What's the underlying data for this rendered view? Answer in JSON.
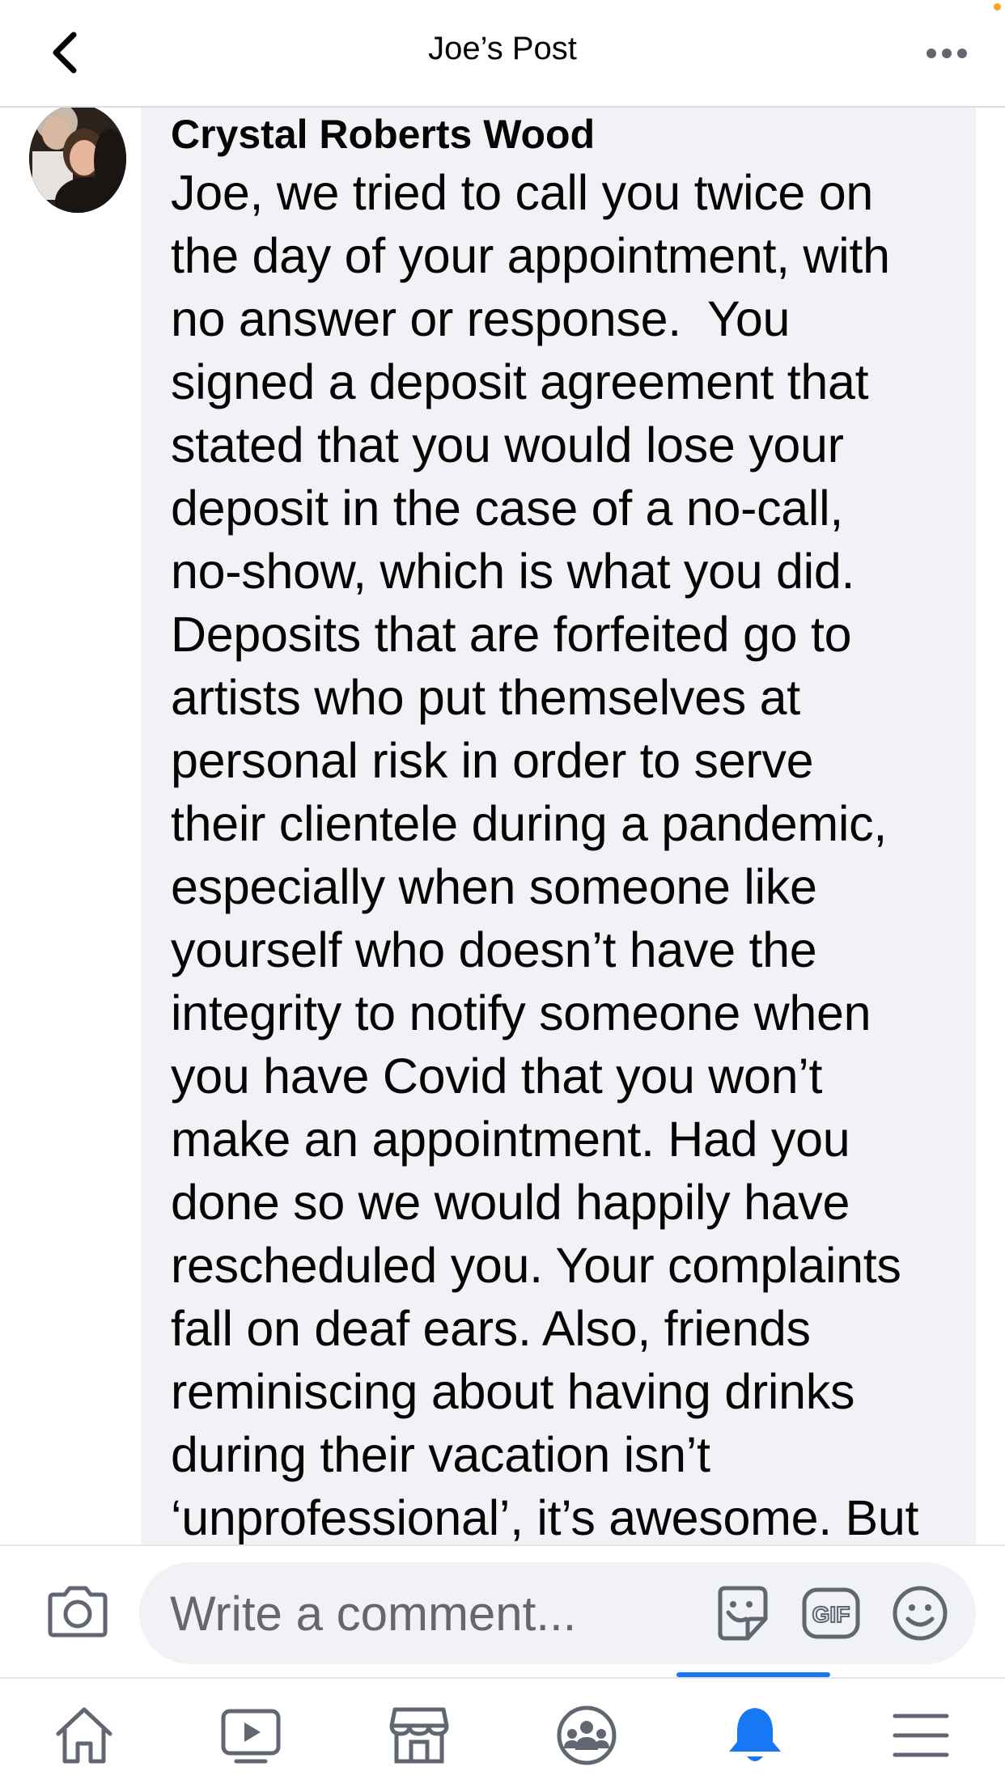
{
  "header": {
    "title": "Joe’s Post",
    "back_icon": "chevron-left-icon",
    "more_icon": "more-dots-icon"
  },
  "comment": {
    "author": "Crystal Roberts Wood",
    "lines": [
      "Joe, we tried to call you twice on",
      "the day of your appointment, with",
      "no answer or response.  You",
      "signed a deposit agreement that",
      "stated that you would lose your",
      "deposit in the case of a no-call,",
      "no-show, which is what you did.",
      "Deposits that are forfeited go to",
      "artists who put themselves at",
      "personal risk in order to serve",
      "their clientele during a pandemic,",
      "especially when someone like",
      "yourself who doesn’t have the",
      "integrity to notify someone when",
      "you have Covid that you won’t",
      "make an appointment. Had you",
      "done so we would happily have",
      "rescheduled you. Your complaints",
      "fall on deaf ears. Also, friends",
      "reminiscing about having drinks",
      "during their vacation isn’t",
      "‘unprofessional’, it’s awesome. But"
    ]
  },
  "composer": {
    "placeholder": "Write a comment...",
    "camera_icon": "camera-icon",
    "sticker_icon": "sticker-icon",
    "gif_label": "GIF",
    "emoji_icon": "emoji-icon"
  },
  "bottom_nav": {
    "items": [
      {
        "icon": "home-icon",
        "active": false
      },
      {
        "icon": "watch-video-icon",
        "active": false
      },
      {
        "icon": "marketplace-icon",
        "active": false
      },
      {
        "icon": "groups-icon",
        "active": false
      },
      {
        "icon": "notifications-bell-icon",
        "active": true
      },
      {
        "icon": "menu-icon",
        "active": false
      }
    ]
  },
  "colors": {
    "accent": "#1877f2",
    "bubble": "#f0f2f5",
    "text": "#050505",
    "secondary_text": "#65676b",
    "icon_gray": "#606770"
  }
}
